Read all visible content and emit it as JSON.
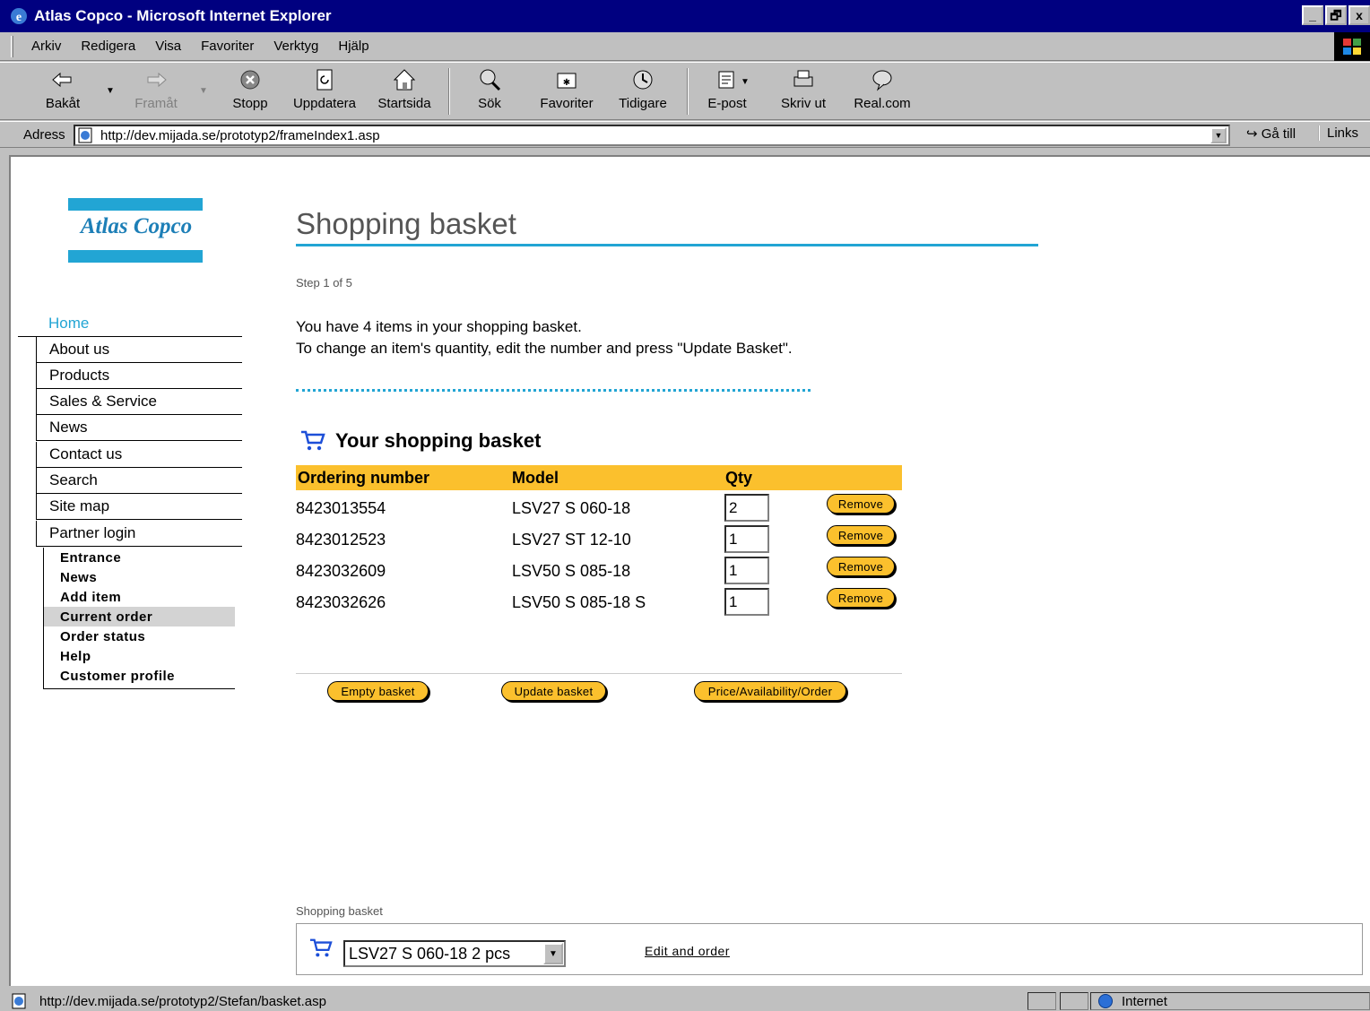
{
  "window": {
    "title": "Atlas Copco - Microsoft Internet Explorer",
    "minimize": "_",
    "maximize": "🗗",
    "close": "x"
  },
  "menu": [
    {
      "label": "Arkiv"
    },
    {
      "label": "Redigera"
    },
    {
      "label": "Visa"
    },
    {
      "label": "Favoriter"
    },
    {
      "label": "Verktyg"
    },
    {
      "label": "Hjälp"
    }
  ],
  "toolbar": {
    "back": "Bakåt",
    "forward": "Framåt",
    "stop": "Stopp",
    "refresh": "Uppdatera",
    "home": "Startsida",
    "search": "Sök",
    "favorites": "Favoriter",
    "history": "Tidigare",
    "mail": "E-post",
    "print": "Skriv ut",
    "real": "Real.com"
  },
  "address": {
    "label": "Adress",
    "url": "http://dev.mijada.se/prototyp2/frameIndex1.asp",
    "go": "Gå till",
    "links": "Links"
  },
  "logo": {
    "text": "Atlas Copco"
  },
  "nav": {
    "home": "Home",
    "items": [
      "About us",
      "Products",
      "Sales & Service",
      "News",
      "Contact us",
      "Search",
      "Site map",
      "Partner login"
    ],
    "sub": [
      "Entrance",
      "News",
      "Add item",
      "Current order",
      "Order status",
      "Help",
      "Customer profile"
    ],
    "active_sub": "Current order"
  },
  "page": {
    "title": "Shopping basket",
    "step": "Step 1 of 5",
    "intro_line1": "You have 4 items in your shopping basket.",
    "intro_line2": "To change an item's quantity, edit the number and press \"Update Basket\"."
  },
  "basket": {
    "heading": "Your shopping basket",
    "columns": {
      "number": "Ordering number",
      "model": "Model",
      "qty": "Qty"
    },
    "rows": [
      {
        "number": "8423013554",
        "model": "LSV27 S 060-18",
        "qty": "2",
        "remove": "Remove"
      },
      {
        "number": "8423012523",
        "model": "LSV27 ST 12-10",
        "qty": "1",
        "remove": "Remove"
      },
      {
        "number": "8423032609",
        "model": "LSV50 S 085-18",
        "qty": "1",
        "remove": "Remove"
      },
      {
        "number": "8423032626",
        "model": "LSV50 S 085-18 S",
        "qty": "1",
        "remove": "Remove"
      }
    ],
    "buttons": {
      "empty": "Empty basket",
      "update": "Update basket",
      "order": "Price/Availability/Order"
    }
  },
  "footer_basket": {
    "label": "Shopping basket",
    "selected": "LSV27 S 060-18 2 pcs",
    "edit_link": "Edit and order"
  },
  "status": {
    "url": "http://dev.mijada.se/prototyp2/Stefan/basket.asp",
    "zone": "Internet"
  },
  "colors": {
    "accent": "#22a5d4",
    "header_yellow": "#fbc02d",
    "titlebar": "#000080"
  }
}
